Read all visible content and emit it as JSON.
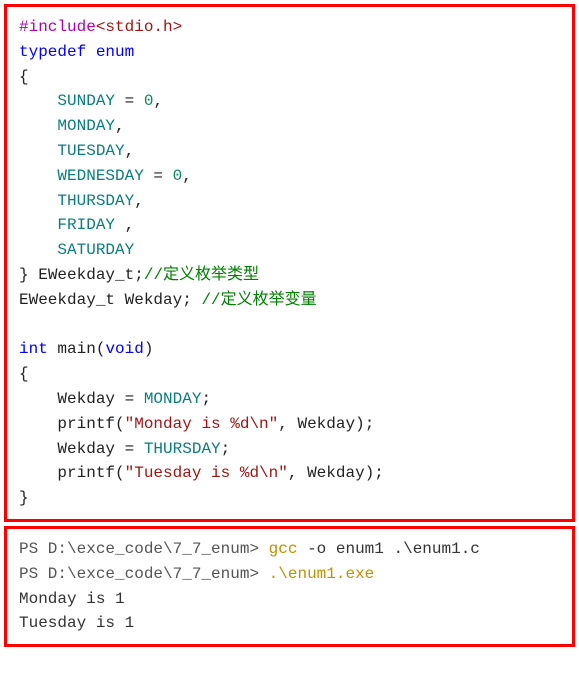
{
  "code": {
    "include_directive": "#include",
    "header_open": "<",
    "header": "stdio.h",
    "header_close": ">",
    "typedef": "typedef",
    "enum": "enum",
    "brace_open": "{",
    "sunday": "SUNDAY",
    "eq": " = ",
    "zero1": "0",
    "comma": ",",
    "monday": "MONDAY",
    "tuesday": "TUESDAY",
    "wednesday": "WEDNESDAY",
    "zero2": "0",
    "thursday": "THURSDAY",
    "friday": "FRIDAY ",
    "saturday": "SATURDAY",
    "brace_close": "}",
    "typename": "EWeekday_t",
    "semi": ";",
    "comment1": "//定义枚举类型",
    "varname": "Wekday",
    "comment2": "//定义枚举变量",
    "int": "int",
    "main": "main",
    "paren_open": "(",
    "void": "void",
    "paren_close": ")",
    "assign1_lhs": "Wekday",
    "assign1_rhs": "MONDAY",
    "printf": "printf",
    "str1": "\"Monday is %d\\n\"",
    "arg1": " Wekday",
    "assign2_rhs": "THURSDAY",
    "str2": "\"Tuesday is %d\\n\""
  },
  "terminal": {
    "prompt1": "PS D:\\exce_code\\7_7_enum>",
    "cmd1a": "gcc",
    "cmd1b": " -o enum1 .\\enum1.c",
    "prompt2": "PS D:\\exce_code\\7_7_enum>",
    "cmd2": ".\\enum1.exe",
    "out1": "Monday is 1",
    "out2": "Tuesday is 1"
  }
}
